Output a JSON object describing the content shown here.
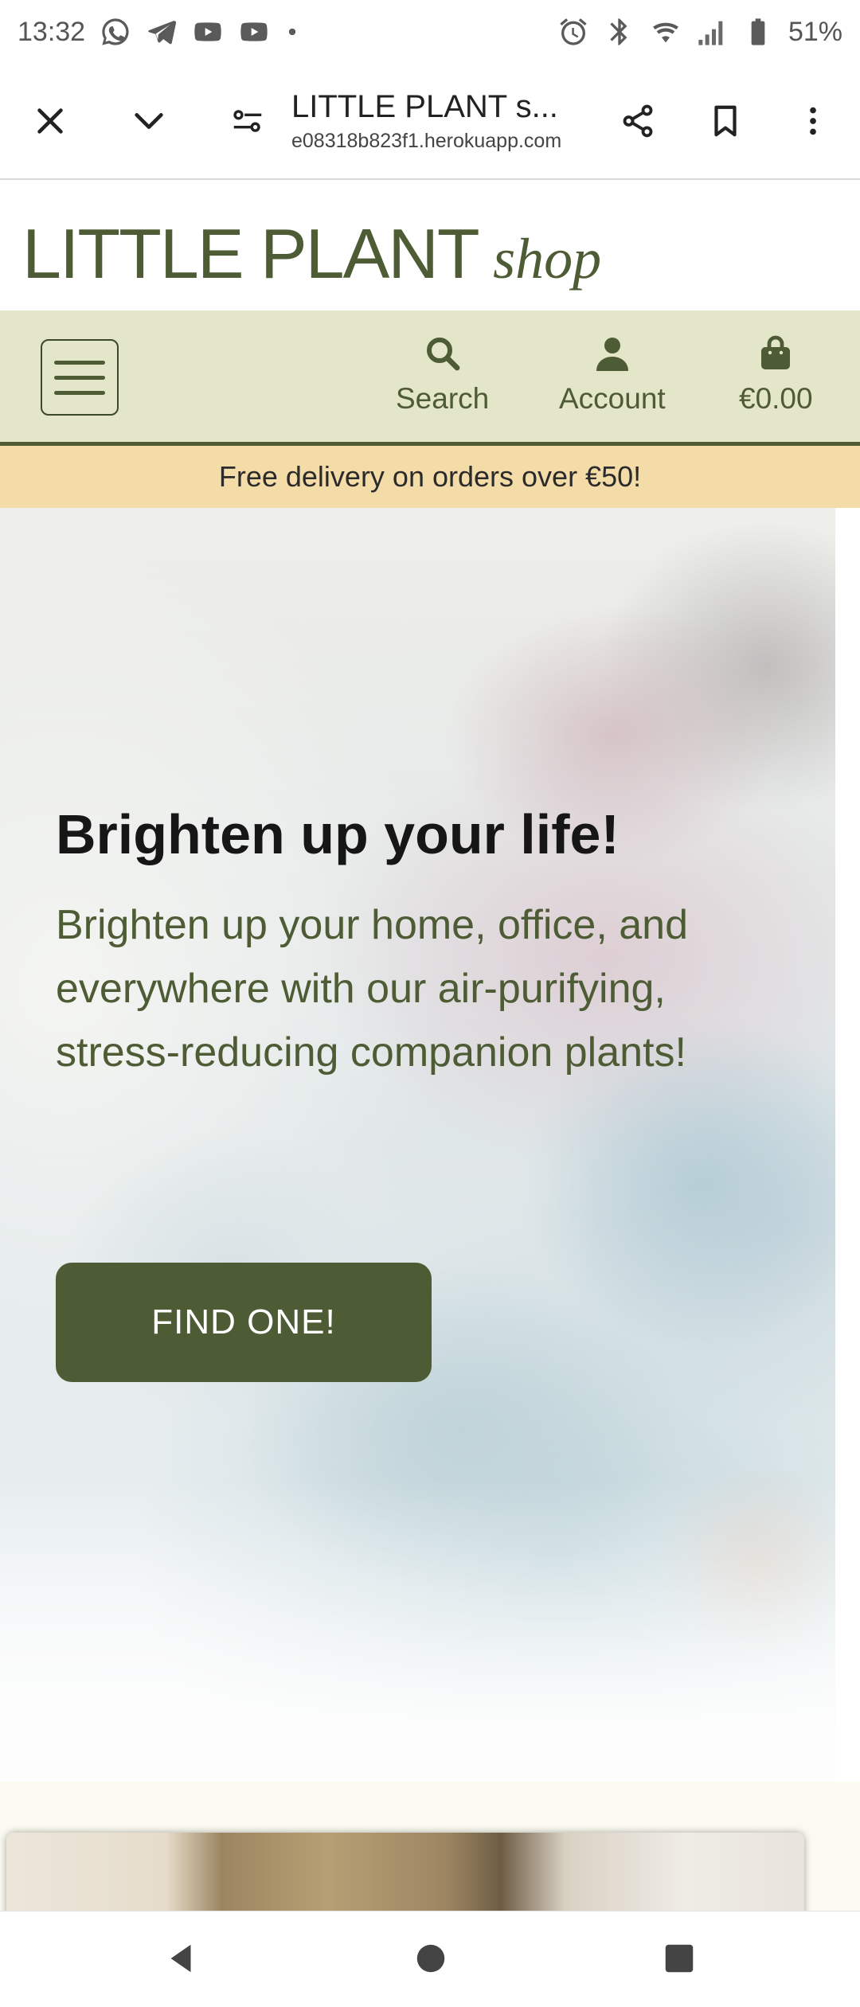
{
  "status_bar": {
    "time": "13:32",
    "battery": "51%",
    "left_icons": [
      "whatsapp-icon",
      "telegram-icon",
      "youtube-icon",
      "youtube-icon",
      "dot-icon"
    ],
    "right_icons": [
      "alarm-icon",
      "bluetooth-icon",
      "wifi-icon",
      "signal-icon",
      "battery-icon"
    ]
  },
  "browser": {
    "title": "LITTLE PLANT s...",
    "url": "e08318b823f1.herokuapp.com",
    "icons": [
      "close-icon",
      "chevron-down-icon",
      "tune-icon",
      "share-icon",
      "bookmark-icon",
      "more-vert-icon"
    ]
  },
  "site": {
    "logo_main": "LITTLE PLANT",
    "logo_sub": "shop",
    "nav": {
      "search_label": "Search",
      "account_label": "Account",
      "cart_label": "€0.00"
    },
    "banner": "Free delivery on orders over €50!",
    "hero": {
      "title": "Brighten up your life!",
      "text": "Brighten up your home, office, and everywhere with our air-purifying, stress-reducing companion plants!",
      "button": "FIND ONE!"
    }
  },
  "colors": {
    "brand_green": "#4e5c35",
    "nav_bg": "#e3e6c8",
    "banner_bg": "#f4dca8"
  }
}
